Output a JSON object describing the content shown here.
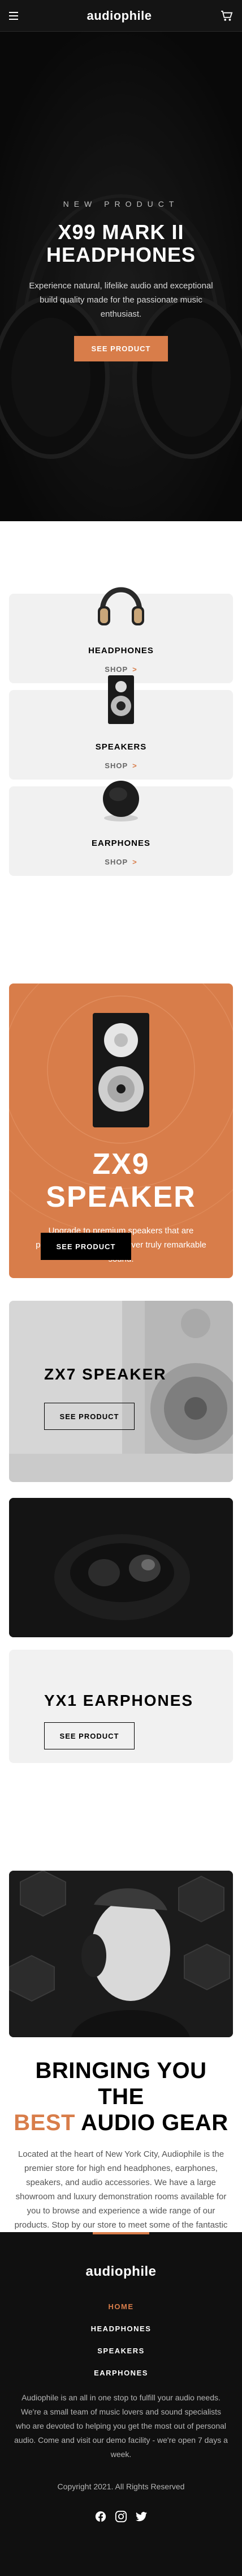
{
  "header": {
    "logo": "audiophile"
  },
  "hero": {
    "overline": "NEW PRODUCT",
    "title": "X99 MARK II HEADPHONES",
    "description": "Experience natural, lifelike audio and exceptional build quality made for the passionate music enthusiast.",
    "cta": "SEE PRODUCT"
  },
  "categories": [
    {
      "name": "HEADPHONES",
      "shop": "SHOP"
    },
    {
      "name": "SPEAKERS",
      "shop": "SHOP"
    },
    {
      "name": "EARPHONES",
      "shop": "SHOP"
    }
  ],
  "zx9": {
    "title_line1": "ZX9",
    "title_line2": "SPEAKER",
    "description": "Upgrade to premium speakers that are phenomenally built to deliver truly remarkable sound.",
    "cta": "SEE PRODUCT"
  },
  "zx7": {
    "title": "ZX7 SPEAKER",
    "cta": "SEE PRODUCT"
  },
  "yx1": {
    "title": "YX1 EARPHONES",
    "cta": "SEE PRODUCT"
  },
  "about": {
    "title_line1": "BRINGING YOU THE",
    "title_accent": "BEST",
    "title_rest": " AUDIO GEAR",
    "text": "Located at the heart of New York City, Audiophile is the premier store for high end headphones, earphones, speakers, and audio accessories. We have a large showroom and luxury demonstration rooms available for you to browse and experience a wide range of our products. Stop by our store to meet some of the fantastic people who make Audiophile the best place to buy your portable audio equipment."
  },
  "footer": {
    "logo": "audiophile",
    "nav": [
      "HOME",
      "HEADPHONES",
      "SPEAKERS",
      "EARPHONES"
    ],
    "description": "Audiophile is an all in one stop to fulfill your audio needs. We're a small team of music lovers and sound specialists who are devoted to helping you get the most out of personal audio. Come and visit our demo facility - we're open 7 days a week.",
    "copyright": "Copyright 2021. All Rights Reserved"
  },
  "colors": {
    "accent": "#d87d4a",
    "dark": "#101010",
    "light_gray": "#f1f1f1"
  },
  "icons": [
    "hamburger-icon",
    "cart-icon",
    "chevron-right-icon",
    "facebook-icon",
    "instagram-icon",
    "twitter-icon"
  ]
}
